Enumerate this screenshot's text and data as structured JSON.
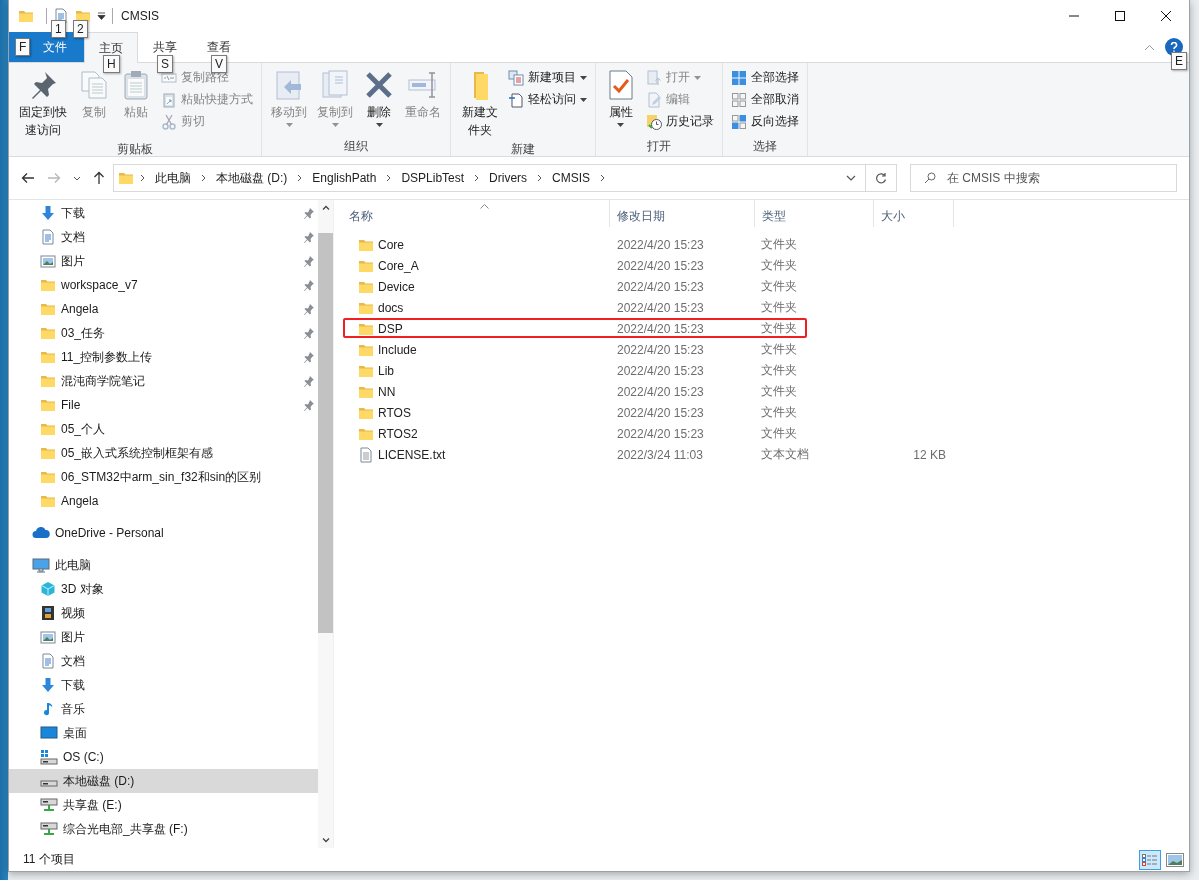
{
  "window": {
    "title": "CMSIS"
  },
  "quick_access_toolbar": [
    {
      "kind": "folder"
    },
    {
      "kind": "properties",
      "key_tip": "1"
    },
    {
      "kind": "new-folder",
      "key_tip": "2"
    }
  ],
  "tabs": [
    {
      "label": "文件",
      "kind": "file",
      "selected": false,
      "key_tip": "F"
    },
    {
      "label": "主页",
      "kind": "normal",
      "selected": true,
      "key_tip": "H"
    },
    {
      "label": "共享",
      "kind": "normal",
      "selected": false,
      "key_tip": "S"
    },
    {
      "label": "查看",
      "kind": "normal",
      "selected": false,
      "key_tip": "V"
    }
  ],
  "help": {
    "key_tip": "E"
  },
  "ribbon": [
    {
      "title": "剪贴板",
      "items": [
        {
          "label": "固定到快速访问",
          "kind": "pin",
          "large": true,
          "disabled": false
        },
        {
          "label": "复制",
          "kind": "copy",
          "large": true,
          "disabled": true
        },
        {
          "label": "粘贴",
          "kind": "paste",
          "large": true,
          "disabled": true
        },
        {
          "label": "复制路径",
          "kind": "copy-path",
          "large": false,
          "disabled": true
        },
        {
          "label": "粘贴快捷方式",
          "kind": "paste-shortcut",
          "large": false,
          "disabled": true
        },
        {
          "label": "剪切",
          "kind": "cut",
          "large": false,
          "disabled": true
        }
      ]
    },
    {
      "title": "组织",
      "items": [
        {
          "label": "移动到",
          "kind": "move-to",
          "large": true,
          "disabled": true,
          "dropdown": true
        },
        {
          "label": "复制到",
          "kind": "copy-to",
          "large": true,
          "disabled": true,
          "dropdown": true
        },
        {
          "label": "删除",
          "kind": "delete",
          "large": true,
          "disabled": false,
          "dropdown": true
        },
        {
          "label": "重命名",
          "kind": "rename",
          "large": true,
          "disabled": true
        }
      ]
    },
    {
      "title": "新建",
      "items": [
        {
          "label": "新建文件夹",
          "kind": "new-folder",
          "large": true,
          "disabled": false
        },
        {
          "label": "新建项目",
          "kind": "new-item",
          "large": false,
          "disabled": false,
          "dropdown": true
        },
        {
          "label": "轻松访问",
          "kind": "easy-access",
          "large": false,
          "disabled": false,
          "dropdown": true
        }
      ]
    },
    {
      "title": "打开",
      "items": [
        {
          "label": "属性",
          "kind": "properties",
          "large": true,
          "disabled": false,
          "dropdown": true
        },
        {
          "label": "打开",
          "kind": "open",
          "large": false,
          "disabled": true,
          "dropdown": true
        },
        {
          "label": "编辑",
          "kind": "edit",
          "large": false,
          "disabled": true
        },
        {
          "label": "历史记录",
          "kind": "history",
          "large": false,
          "disabled": false
        }
      ]
    },
    {
      "title": "选择",
      "items": [
        {
          "label": "全部选择",
          "kind": "select-all",
          "large": false,
          "disabled": false
        },
        {
          "label": "全部取消",
          "kind": "select-none",
          "large": false,
          "disabled": false
        },
        {
          "label": "反向选择",
          "kind": "invert-selection",
          "large": false,
          "disabled": false
        }
      ]
    }
  ],
  "address_bar": {
    "back": {
      "disabled": false
    },
    "forward": {
      "disabled": true
    },
    "breadcrumb": [
      "此电脑",
      "本地磁盘 (D:)",
      "EnglishPath",
      "DSPLibTest",
      "Drivers",
      "CMSIS"
    ],
    "search": {
      "placeholder": "在 CMSIS 中搜索"
    }
  },
  "navigation": {
    "quick_access": [
      {
        "label": "下载",
        "kind": "download",
        "pinned": true,
        "selected": false
      },
      {
        "label": "文档",
        "kind": "document",
        "pinned": true,
        "selected": false
      },
      {
        "label": "图片",
        "kind": "pictures",
        "pinned": true,
        "selected": false
      },
      {
        "label": "workspace_v7",
        "kind": "folder",
        "pinned": true,
        "selected": false
      },
      {
        "label": "Angela",
        "kind": "folder",
        "pinned": true,
        "selected": false
      },
      {
        "label": "03_任务",
        "kind": "folder",
        "pinned": true,
        "selected": false
      },
      {
        "label": "11_控制参数上传",
        "kind": "folder",
        "pinned": true,
        "selected": false
      },
      {
        "label": "混沌商学院笔记",
        "kind": "folder",
        "pinned": true,
        "selected": false
      },
      {
        "label": "File",
        "kind": "folder",
        "pinned": true,
        "selected": false
      },
      {
        "label": "05_个人",
        "kind": "folder",
        "pinned": false,
        "selected": false
      },
      {
        "label": "05_嵌入式系统控制框架有感",
        "kind": "folder",
        "pinned": false,
        "selected": false
      },
      {
        "label": "06_STM32中arm_sin_f32和sin的区别",
        "kind": "folder",
        "pinned": false,
        "selected": false
      },
      {
        "label": "Angela",
        "kind": "folder",
        "pinned": false,
        "selected": false
      }
    ],
    "sections": [
      {
        "label": "OneDrive - Personal",
        "kind": "cloud",
        "selected": false
      },
      {
        "label": "此电脑",
        "kind": "pc",
        "selected": false,
        "children": [
          {
            "label": "3D 对象",
            "kind": "cube",
            "selected": false
          },
          {
            "label": "视频",
            "kind": "video",
            "selected": false
          },
          {
            "label": "图片",
            "kind": "pictures",
            "selected": false
          },
          {
            "label": "文档",
            "kind": "document",
            "selected": false
          },
          {
            "label": "下载",
            "kind": "download",
            "selected": false
          },
          {
            "label": "音乐",
            "kind": "music",
            "selected": false
          },
          {
            "label": "桌面",
            "kind": "desktop",
            "selected": false
          },
          {
            "label": "OS (C:)",
            "kind": "os-drive",
            "selected": false
          },
          {
            "label": "本地磁盘 (D:)",
            "kind": "drive",
            "selected": true
          },
          {
            "label": "共享盘 (E:)",
            "kind": "net-drive",
            "selected": false
          },
          {
            "label": "综合光电部_共享盘 (F:)",
            "kind": "net-drive",
            "selected": false
          }
        ]
      }
    ]
  },
  "file_list": {
    "columns": [
      "名称",
      "修改日期",
      "类型",
      "大小"
    ],
    "rows": [
      {
        "name": "Core",
        "modified": "2022/4/20 15:23",
        "type": "文件夹",
        "kind": "folder",
        "marked": false
      },
      {
        "name": "Core_A",
        "modified": "2022/4/20 15:23",
        "type": "文件夹",
        "kind": "folder",
        "marked": false
      },
      {
        "name": "Device",
        "modified": "2022/4/20 15:23",
        "type": "文件夹",
        "kind": "folder",
        "marked": false
      },
      {
        "name": "docs",
        "modified": "2022/4/20 15:23",
        "type": "文件夹",
        "kind": "folder",
        "marked": false
      },
      {
        "name": "DSP",
        "modified": "2022/4/20 15:23",
        "type": "文件夹",
        "kind": "folder",
        "marked": true
      },
      {
        "name": "Include",
        "modified": "2022/4/20 15:23",
        "type": "文件夹",
        "kind": "folder",
        "marked": false
      },
      {
        "name": "Lib",
        "modified": "2022/4/20 15:23",
        "type": "文件夹",
        "kind": "folder",
        "marked": false
      },
      {
        "name": "NN",
        "modified": "2022/4/20 15:23",
        "type": "文件夹",
        "kind": "folder",
        "marked": false
      },
      {
        "name": "RTOS",
        "modified": "2022/4/20 15:23",
        "type": "文件夹",
        "kind": "folder",
        "marked": false
      },
      {
        "name": "RTOS2",
        "modified": "2022/4/20 15:23",
        "type": "文件夹",
        "kind": "folder",
        "marked": false
      },
      {
        "name": "LICENSE.txt",
        "modified": "2022/3/24 11:03",
        "type": "文本文档",
        "size": "12 KB",
        "kind": "text",
        "marked": false
      }
    ]
  },
  "status_bar": {
    "item_count": "11 个项目",
    "views": [
      {
        "kind": "details",
        "selected": true
      },
      {
        "kind": "large-icons",
        "selected": false
      }
    ]
  }
}
